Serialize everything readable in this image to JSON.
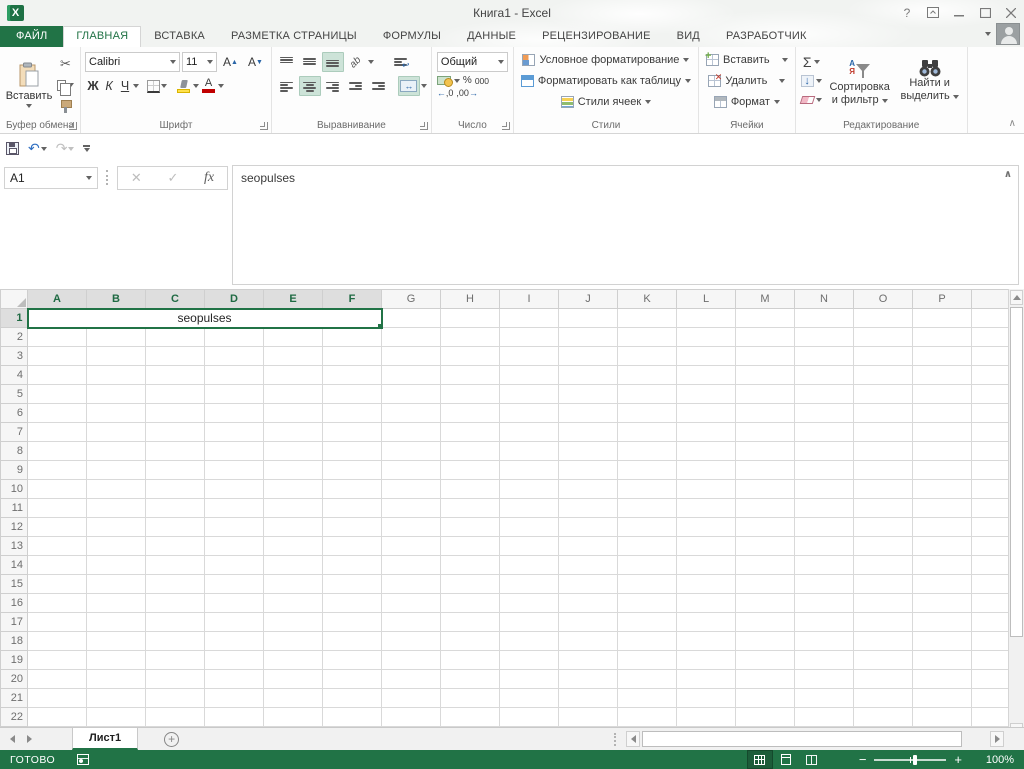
{
  "titlebar": {
    "title": "Книга1 - Excel",
    "help": "?"
  },
  "tabs": {
    "file": "ФАЙЛ",
    "items": [
      "ГЛАВНАЯ",
      "ВСТАВКА",
      "РАЗМЕТКА СТРАНИЦЫ",
      "ФОРМУЛЫ",
      "ДАННЫЕ",
      "РЕЦЕНЗИРОВАНИЕ",
      "ВИД",
      "РАЗРАБОТЧИК"
    ]
  },
  "ribbon": {
    "clipboard": {
      "paste": "Вставить",
      "label": "Буфер обмена"
    },
    "font": {
      "family": "Calibri",
      "size": "11",
      "bold": "Ж",
      "italic": "К",
      "underline": "Ч",
      "grow": "A",
      "shrink": "A",
      "color_letter": "А",
      "label": "Шрифт"
    },
    "alignment": {
      "orientation": "ab",
      "label": "Выравнивание"
    },
    "number": {
      "format": "Общий",
      "percent": "%",
      "thousands": "000",
      "inc_decimal": "←,0",
      "dec_decimal": ",00→",
      "label": "Число"
    },
    "styles": {
      "conditional": "Условное форматирование",
      "format_table": "Форматировать как таблицу",
      "cell_styles": "Стили ячеек",
      "label": "Стили"
    },
    "cells": {
      "insert": "Вставить",
      "delete": "Удалить",
      "format": "Формат",
      "label": "Ячейки"
    },
    "editing": {
      "autosum": "Σ",
      "fill": "↓",
      "sort_letter_top": "А",
      "sort_letter_bottom": "Я",
      "sort_line1": "Сортировка",
      "sort_line2": "и фильтр",
      "find_line1": "Найти и",
      "find_line2": "выделить",
      "label": "Редактирование"
    }
  },
  "formula_bar": {
    "name_box": "A1",
    "cancel": "✕",
    "enter": "✓",
    "fx": "fx",
    "content": "seopulses"
  },
  "grid": {
    "columns": [
      "A",
      "B",
      "C",
      "D",
      "E",
      "F",
      "G",
      "H",
      "I",
      "J",
      "K",
      "L",
      "M",
      "N",
      "O",
      "P"
    ],
    "visible_rows": 23,
    "merged_cell": {
      "row": 1,
      "col_span": 6,
      "range": "A1:F1",
      "value": "seopulses"
    }
  },
  "sheetbar": {
    "tab": "Лист1",
    "add_sheet": "+"
  },
  "statusbar": {
    "mode": "ГОТОВО",
    "zoom_out": "−",
    "zoom_in": "+",
    "zoom_level": "100%"
  },
  "colors": {
    "accent": "#217346",
    "toggle_active": "#cde3d8",
    "grid_line": "#d9d9d9",
    "fill_yellow": "#ffe14d",
    "font_red": "#c00000"
  }
}
